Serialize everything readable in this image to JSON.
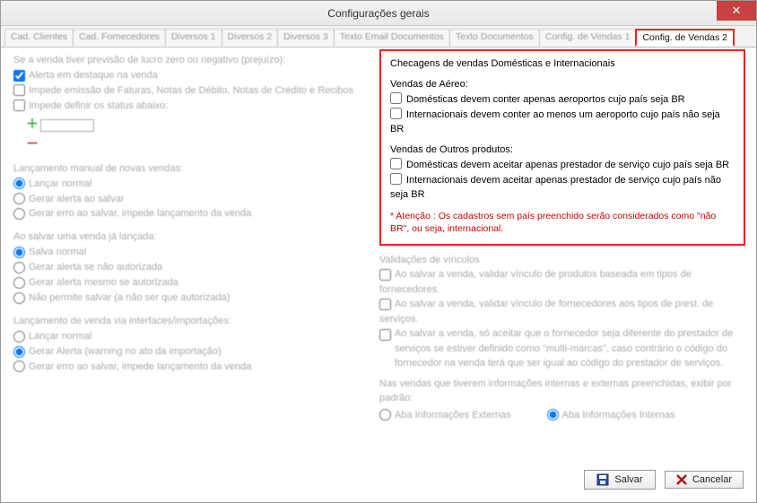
{
  "window": {
    "title": "Configurações gerais"
  },
  "tabs": {
    "t0": "Cad. Clientes",
    "t1": "Cad. Fornecedores",
    "t2": "Diversos 1",
    "t3": "Diversos 2",
    "t4": "Diversos 3",
    "t5": "Texto Email Documentos",
    "t6": "Texto Documentos",
    "t7": "Config. de Vendas 1",
    "t8": "Config. de Vendas 2"
  },
  "left": {
    "l1": "Se a venda tiver previsão de lucro zero ou negativo (prejuízo):",
    "l2": "Alerta em destaque na venda",
    "l3": "Impede emissão de Faturas, Notas de Débito, Notas de Crédito e Recibos",
    "l4": "Impede definir os status abaixo:",
    "g1": "Lançamento manual de novas vendas:",
    "g1a": "Lançar normal",
    "g1b": "Gerar alerta ao salvar",
    "g1c": "Gerar erro ao salvar, impede lançamento da venda",
    "g2": "Ao salvar uma venda já lançada:",
    "g2a": "Salva normal",
    "g2b": "Gerar alerta se não autorizada",
    "g2c": "Gerar alerta mesmo se autorizada",
    "g2d": "Não permite salvar (a não ser que autorizada)",
    "g3": "Lançamento de venda via interfaces/importações:",
    "g3a": "Lançar normal",
    "g3b": "Gerar Alerta (warning no ato da importação)",
    "g3c": "Gerar erro ao salvar, impede lançamento da venda"
  },
  "box": {
    "heading": "Checagens de vendas Domésticas e Internacionais",
    "aereo": "Vendas de Aéreo:",
    "a1": "Domésticas devem conter apenas aeroportos cujo país seja BR",
    "a2": "Internacionais devem conter ao menos um aeroporto cujo país não seja BR",
    "outros": "Vendas de Outros produtos:",
    "o1": "Domésticas devem aceitar apenas prestador de serviço cujo país seja BR",
    "o2": "Internacionais devem aceitar apenas prestador de serviço cujo país não seja BR",
    "att": "* Atenção : Os cadastros sem país preenchido serão considerados como \"não BR\", ou seja, internacional."
  },
  "below": {
    "h1": "Validações de vínculos",
    "c1": "Ao salvar a venda, validar vínculo de produtos baseada em tipos de fornecedores.",
    "c2": "Ao salvar a venda, validar vínculo de fornecedores aos tipos de prest. de serviços.",
    "c3": "Ao salvar a venda, só aceitar que o fornecedor seja diferente do prestador de serviços se estiver definido como \"multi-marcas\", caso contrário o código do fornecedor na venda terá que ser igual ao código do prestador de serviços.",
    "h2": "Nas vendas que tiverem informações internas e externas preenchidas, exibir por padrão:",
    "r1": "Aba Informações Externas",
    "r2": "Aba Informações Internas"
  },
  "footer": {
    "save": "Salvar",
    "cancel": "Cancelar"
  }
}
